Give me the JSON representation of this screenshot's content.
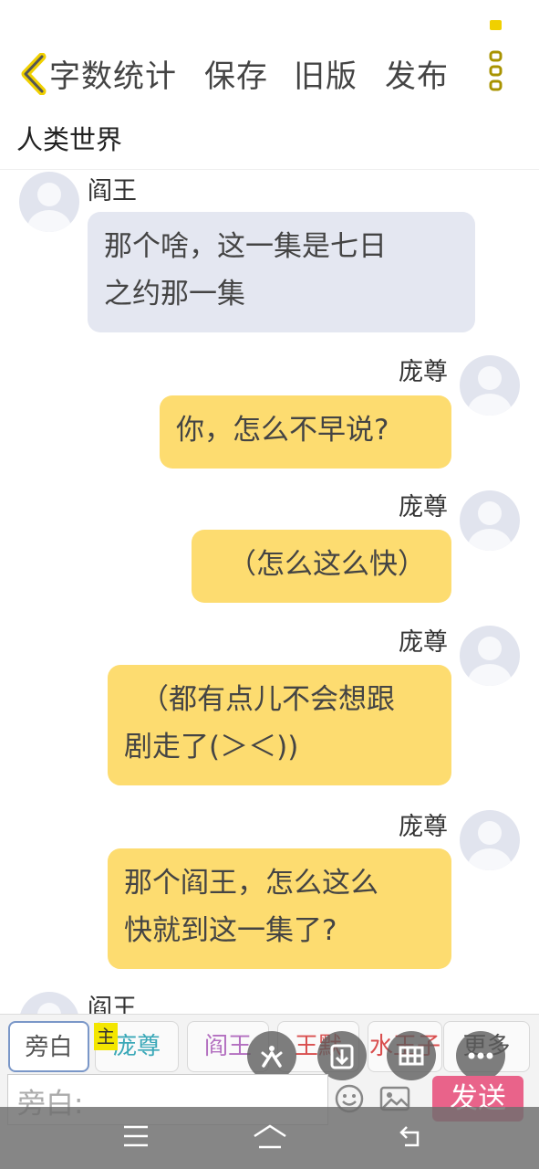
{
  "toolbar": {
    "items": [
      "字数统计",
      "保存",
      "旧版",
      "发布"
    ]
  },
  "chat": {
    "title": "人类世界",
    "messages": [
      {
        "sender": "阎王",
        "side": "left",
        "lines": [
          "那个啥，这一集是七日",
          "之约那一集"
        ]
      },
      {
        "sender": "庞尊",
        "side": "right",
        "lines": [
          "你，怎么不早说?"
        ]
      },
      {
        "sender": "庞尊",
        "side": "right",
        "lines": [
          "（怎么这么快）"
        ]
      },
      {
        "sender": "庞尊",
        "side": "right",
        "lines": [
          "（都有点儿不会想跟",
          "剧走了(＞＜))"
        ]
      },
      {
        "sender": "庞尊",
        "side": "right",
        "lines": [
          "那个阎王，怎么这么",
          "快就到这一集了?"
        ]
      },
      {
        "sender": "阎王",
        "side": "left",
        "lines": []
      }
    ]
  },
  "roles": {
    "main_badge": "主",
    "tabs": [
      {
        "label": "旁白",
        "color": "#555555"
      },
      {
        "label": "庞尊",
        "color": "#3aa8b8"
      },
      {
        "label": "阎王",
        "color": "#b36fc0"
      },
      {
        "label": "王默",
        "color": "#d94f4f"
      },
      {
        "label": "水王子",
        "color": "#d94f4f"
      },
      {
        "label": "更多",
        "color": "#555555"
      }
    ]
  },
  "composer": {
    "placeholder": "旁白:",
    "send_label": "发送",
    "send_color": "#e9638a"
  },
  "colors": {
    "accent_yellow": "#f0d000",
    "right_bubble": "#fddc70",
    "left_bubble": "#e4e7f1"
  }
}
